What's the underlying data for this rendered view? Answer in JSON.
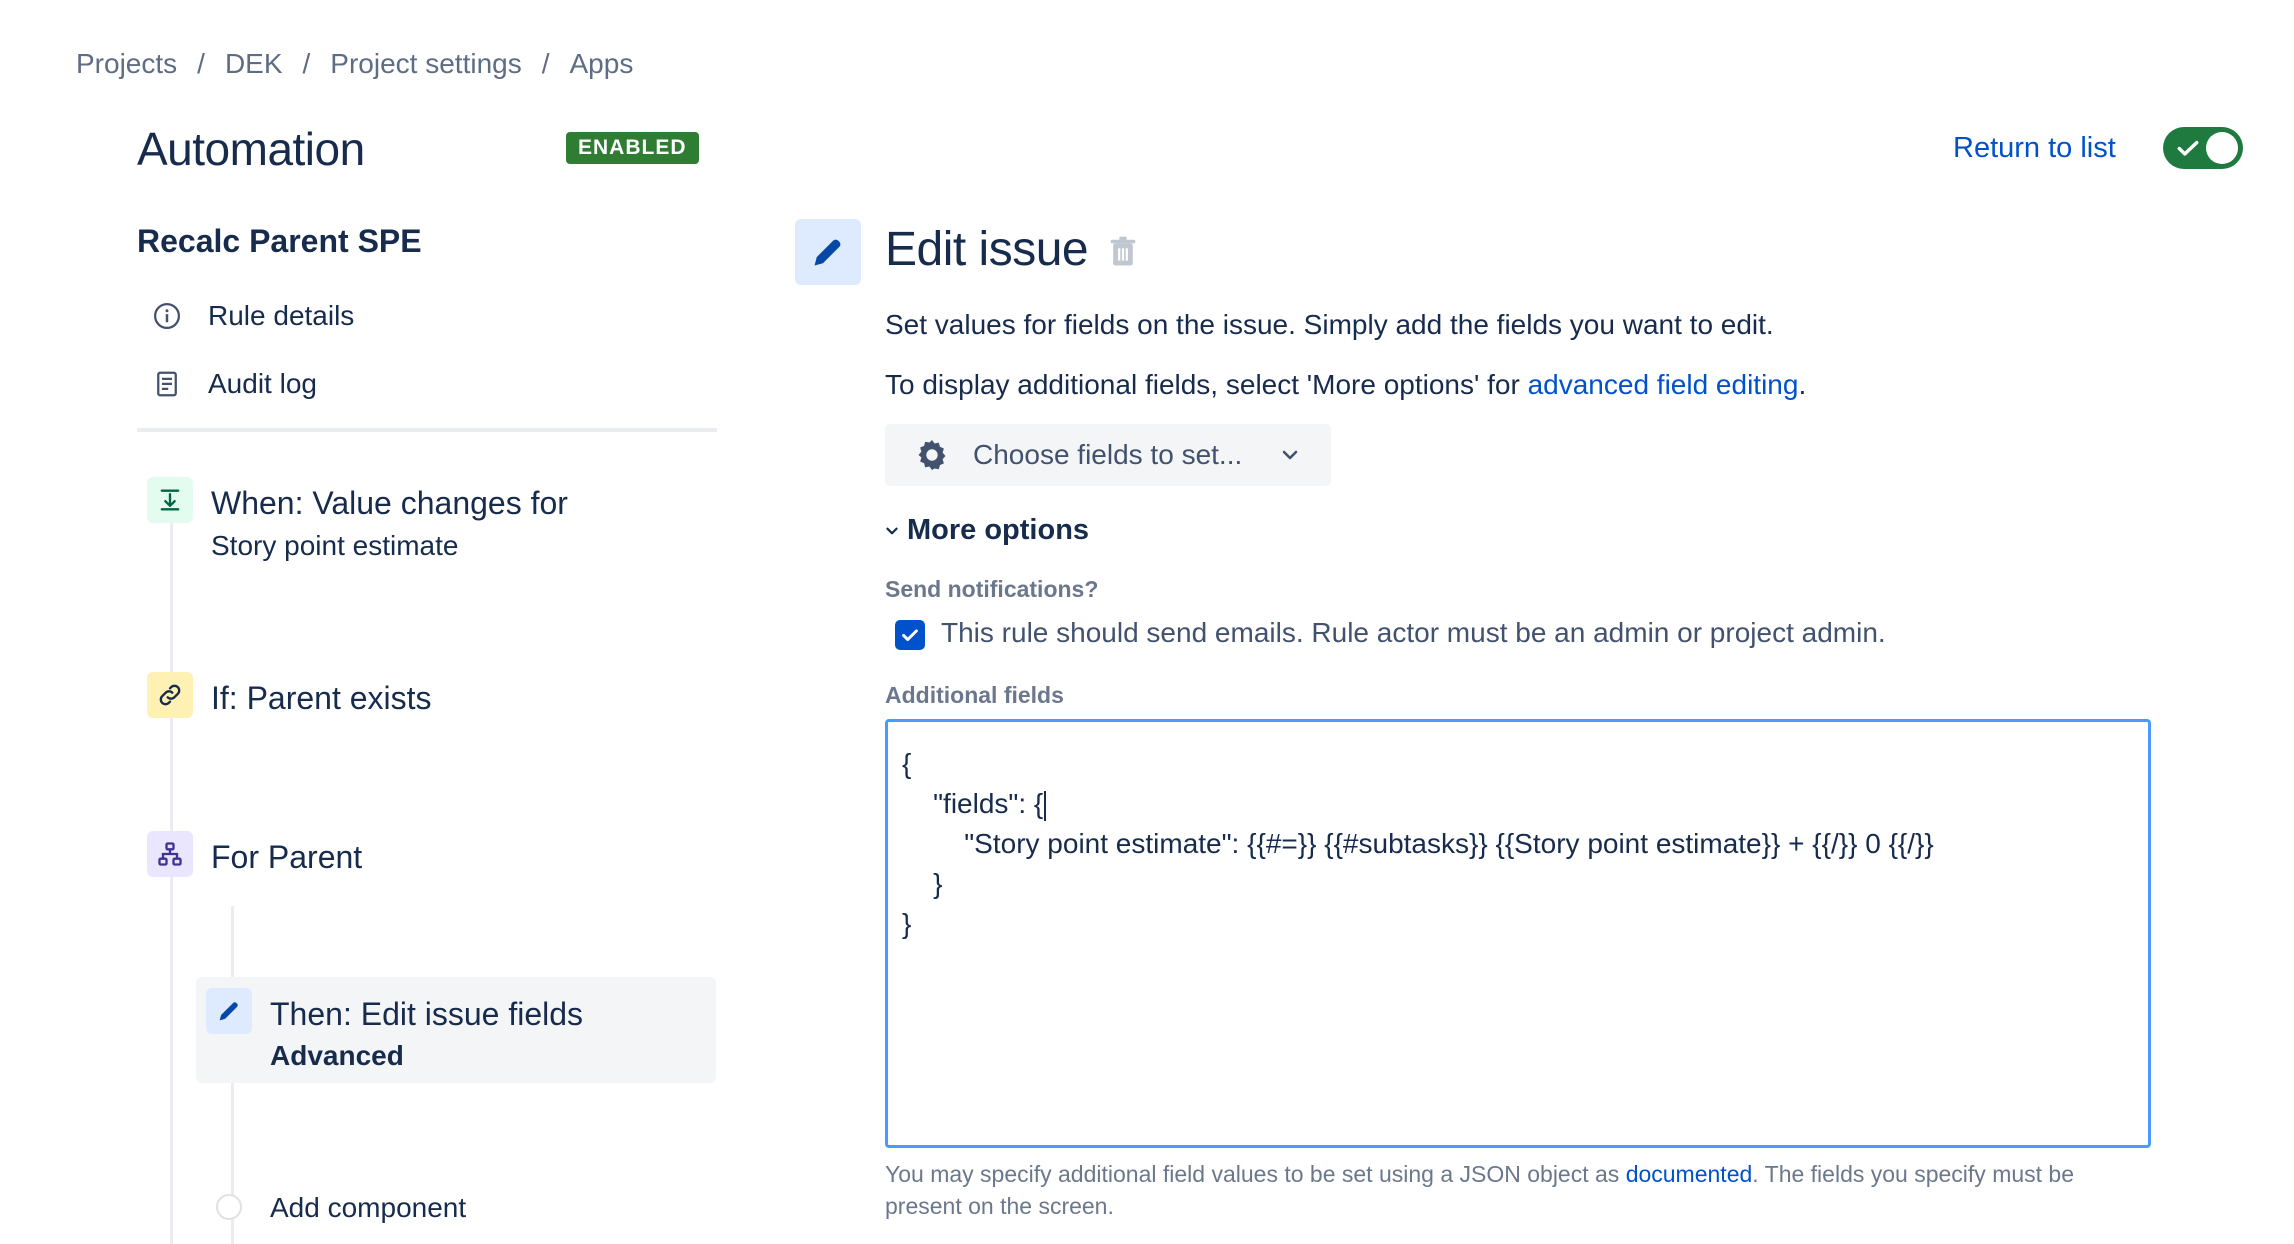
{
  "breadcrumb": [
    "Projects",
    "DEK",
    "Project settings",
    "Apps"
  ],
  "breadcrumb_separator": "/",
  "header": {
    "title": "Automation",
    "status_badge": "ENABLED",
    "return_link": "Return to list",
    "toggle_on": true
  },
  "sidebar": {
    "rule_name": "Recalc Parent SPE",
    "nav": [
      {
        "label": "Rule details",
        "icon": "info-icon"
      },
      {
        "label": "Audit log",
        "icon": "document-icon"
      }
    ],
    "steps": [
      {
        "title": "When: Value changes for",
        "subtitle": "Story point estimate",
        "icon": "trigger-icon",
        "color": "#e3fcef"
      },
      {
        "title": "If: Parent exists",
        "subtitle": "",
        "icon": "link-icon",
        "color": "#fff0b3"
      },
      {
        "title": "For Parent",
        "subtitle": "",
        "icon": "hierarchy-icon",
        "color": "#eae6ff"
      },
      {
        "title": "Then: Edit issue fields",
        "subtitle": "Advanced",
        "icon": "pencil-icon",
        "color": "#deebff"
      }
    ],
    "add_component": "Add component"
  },
  "main": {
    "title": "Edit issue",
    "desc1": "Set values for fields on the issue. Simply add the fields you want to edit.",
    "desc2_prefix": "To display additional fields, select 'More options' for ",
    "desc2_link": "advanced field editing",
    "desc2_suffix": ".",
    "choose_fields": "Choose fields to set...",
    "more_options": "More options",
    "send_notifications_label": "Send notifications?",
    "send_notifications_text": "This rule should send emails. Rule actor must be an admin or project admin.",
    "send_notifications_checked": true,
    "additional_fields_label": "Additional fields",
    "json_lines": [
      "{",
      "    \"fields\": {",
      "        \"Story point estimate\": {{#=}} {{#subtasks}} {{Story point estimate}} + {{/}} 0 {{/}}",
      "    }",
      "}"
    ],
    "help_prefix": "You may specify additional field values to be set using a JSON object as ",
    "help_link": "documented",
    "help_suffix": ". The fields you specify must be present on the screen."
  },
  "colors": {
    "accent": "#0052cc",
    "enabled": "#2e7d32",
    "focus_border": "#4c9aff"
  }
}
